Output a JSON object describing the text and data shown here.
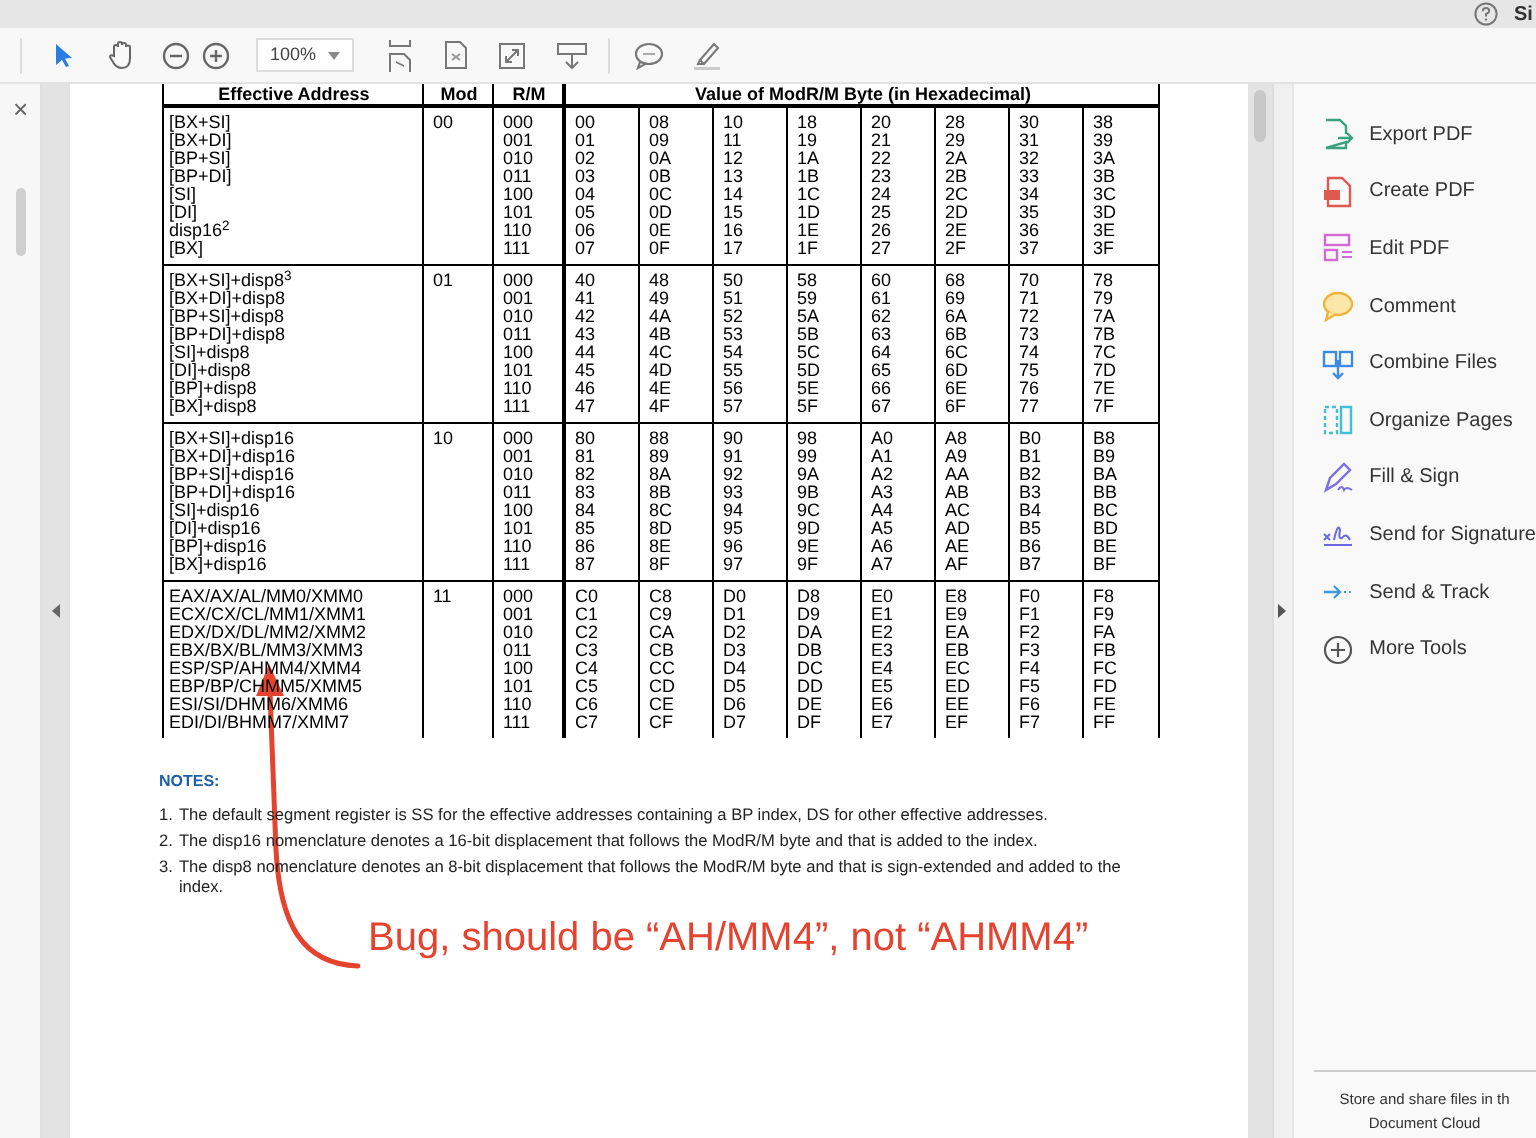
{
  "top_bar": {
    "text": "Si"
  },
  "toolbar": {
    "zoom": "100%"
  },
  "left_panel": {
    "close": "×"
  },
  "table": {
    "columns": [
      "Effective Address",
      "Mod",
      "R/M",
      "Value of ModR/M Byte (in Hexadecimal)"
    ],
    "groups": [
      {
        "mod": "00",
        "rows": [
          {
            "address": "[BX+SI]",
            "rm": "000",
            "values": [
              "00",
              "08",
              "10",
              "18",
              "20",
              "28",
              "30",
              "38"
            ]
          },
          {
            "address": "[BX+DI]",
            "rm": "001",
            "values": [
              "01",
              "09",
              "11",
              "19",
              "21",
              "29",
              "31",
              "39"
            ]
          },
          {
            "address": "[BP+SI]",
            "rm": "010",
            "values": [
              "02",
              "0A",
              "12",
              "1A",
              "22",
              "2A",
              "32",
              "3A"
            ]
          },
          {
            "address": "[BP+DI]",
            "rm": "011",
            "values": [
              "03",
              "0B",
              "13",
              "1B",
              "23",
              "2B",
              "33",
              "3B"
            ]
          },
          {
            "address": "[SI]",
            "rm": "100",
            "values": [
              "04",
              "0C",
              "14",
              "1C",
              "24",
              "2C",
              "34",
              "3C"
            ]
          },
          {
            "address": "[DI]",
            "rm": "101",
            "values": [
              "05",
              "0D",
              "15",
              "1D",
              "25",
              "2D",
              "35",
              "3D"
            ]
          },
          {
            "address": "disp16$^{2}$",
            "rm": "110",
            "values": [
              "06",
              "0E",
              "16",
              "1E",
              "26",
              "2E",
              "36",
              "3E"
            ]
          },
          {
            "address": "[BX]",
            "rm": "111",
            "values": [
              "07",
              "0F",
              "17",
              "1F",
              "27",
              "2F",
              "37",
              "3F"
            ]
          }
        ]
      },
      {
        "mod": "01",
        "rows": [
          {
            "address": "[BX+SI]+disp8$^{3}$",
            "rm": "000",
            "values": [
              "40",
              "48",
              "50",
              "58",
              "60",
              "68",
              "70",
              "78"
            ]
          },
          {
            "address": "[BX+DI]+disp8",
            "rm": "001",
            "values": [
              "41",
              "49",
              "51",
              "59",
              "61",
              "69",
              "71",
              "79"
            ]
          },
          {
            "address": "[BP+SI]+disp8",
            "rm": "010",
            "values": [
              "42",
              "4A",
              "52",
              "5A",
              "62",
              "6A",
              "72",
              "7A"
            ]
          },
          {
            "address": "[BP+DI]+disp8",
            "rm": "011",
            "values": [
              "43",
              "4B",
              "53",
              "5B",
              "63",
              "6B",
              "73",
              "7B"
            ]
          },
          {
            "address": "[SI]+disp8",
            "rm": "100",
            "values": [
              "44",
              "4C",
              "54",
              "5C",
              "64",
              "6C",
              "74",
              "7C"
            ]
          },
          {
            "address": "[DI]+disp8",
            "rm": "101",
            "values": [
              "45",
              "4D",
              "55",
              "5D",
              "65",
              "6D",
              "75",
              "7D"
            ]
          },
          {
            "address": "[BP]+disp8",
            "rm": "110",
            "values": [
              "46",
              "4E",
              "56",
              "5E",
              "66",
              "6E",
              "76",
              "7E"
            ]
          },
          {
            "address": "[BX]+disp8",
            "rm": "111",
            "values": [
              "47",
              "4F",
              "57",
              "5F",
              "67",
              "6F",
              "77",
              "7F"
            ]
          }
        ]
      },
      {
        "mod": "10",
        "rows": [
          {
            "address": "[BX+SI]+disp16",
            "rm": "000",
            "values": [
              "80",
              "88",
              "90",
              "98",
              "A0",
              "A8",
              "B0",
              "B8"
            ]
          },
          {
            "address": "[BX+DI]+disp16",
            "rm": "001",
            "values": [
              "81",
              "89",
              "91",
              "99",
              "A1",
              "A9",
              "B1",
              "B9"
            ]
          },
          {
            "address": "[BP+SI]+disp16",
            "rm": "010",
            "values": [
              "82",
              "8A",
              "92",
              "9A",
              "A2",
              "AA",
              "B2",
              "BA"
            ]
          },
          {
            "address": "[BP+DI]+disp16",
            "rm": "011",
            "values": [
              "83",
              "8B",
              "93",
              "9B",
              "A3",
              "AB",
              "B3",
              "BB"
            ]
          },
          {
            "address": "[SI]+disp16",
            "rm": "100",
            "values": [
              "84",
              "8C",
              "94",
              "9C",
              "A4",
              "AC",
              "B4",
              "BC"
            ]
          },
          {
            "address": "[DI]+disp16",
            "rm": "101",
            "values": [
              "85",
              "8D",
              "95",
              "9D",
              "A5",
              "AD",
              "B5",
              "BD"
            ]
          },
          {
            "address": "[BP]+disp16",
            "rm": "110",
            "values": [
              "86",
              "8E",
              "96",
              "9E",
              "A6",
              "AE",
              "B6",
              "BE"
            ]
          },
          {
            "address": "[BX]+disp16",
            "rm": "111",
            "values": [
              "87",
              "8F",
              "97",
              "9F",
              "A7",
              "AF",
              "B7",
              "BF"
            ]
          }
        ]
      },
      {
        "mod": "11",
        "rows": [
          {
            "address": "EAX/AX/AL/MM0/XMM0",
            "rm": "000",
            "values": [
              "C0",
              "C8",
              "D0",
              "D8",
              "E0",
              "E8",
              "F0",
              "F8"
            ]
          },
          {
            "address": "ECX/CX/CL/MM1/XMM1",
            "rm": "001",
            "values": [
              "C1",
              "C9",
              "D1",
              "D9",
              "E1",
              "E9",
              "F1",
              "F9"
            ]
          },
          {
            "address": "EDX/DX/DL/MM2/XMM2",
            "rm": "010",
            "values": [
              "C2",
              "CA",
              "D2",
              "DA",
              "E2",
              "EA",
              "F2",
              "FA"
            ]
          },
          {
            "address": "EBX/BX/BL/MM3/XMM3",
            "rm": "011",
            "values": [
              "C3",
              "CB",
              "D3",
              "DB",
              "E3",
              "EB",
              "F3",
              "FB"
            ]
          },
          {
            "address": "ESP/SP/AHMM4/XMM4",
            "rm": "100",
            "values": [
              "C4",
              "CC",
              "D4",
              "DC",
              "E4",
              "EC",
              "F4",
              "FC"
            ]
          },
          {
            "address": "EBP/BP/CHMM5/XMM5",
            "rm": "101",
            "values": [
              "C5",
              "CD",
              "D5",
              "DD",
              "E5",
              "ED",
              "F5",
              "FD"
            ]
          },
          {
            "address": "ESI/SI/DHMM6/XMM6",
            "rm": "110",
            "values": [
              "C6",
              "CE",
              "D6",
              "DE",
              "E6",
              "EE",
              "F6",
              "FE"
            ]
          },
          {
            "address": "EDI/DI/BHMM7/XMM7",
            "rm": "111",
            "values": [
              "C7",
              "CF",
              "D7",
              "DF",
              "E7",
              "EF",
              "F7",
              "FF"
            ]
          }
        ]
      }
    ]
  },
  "notes": {
    "heading": "NOTES:",
    "items": [
      {
        "number": "1.",
        "text": "The default segment register is SS for the effective addresses containing a BP index, DS for other effective addresses."
      },
      {
        "number": "2.",
        "text": "The disp16 nomenclature denotes a 16-bit displacement that follows the ModR/M byte and that is added to the index."
      },
      {
        "number": "3.",
        "text": "The disp8 nomenclature denotes an 8-bit displacement that follows the ModR/M byte and that is sign-extended and added to the index."
      }
    ]
  },
  "annotation": {
    "text": "Bug, should be “AH/MM4”, not “AHMM4”"
  },
  "tools_panel": {
    "items": [
      {
        "kind": "export",
        "label": "Export PDF"
      },
      {
        "kind": "create",
        "label": "Create PDF"
      },
      {
        "kind": "edit",
        "label": "Edit PDF"
      },
      {
        "kind": "comment",
        "label": "Comment"
      },
      {
        "kind": "combine",
        "label": "Combine Files"
      },
      {
        "kind": "organize",
        "label": "Organize Pages"
      },
      {
        "kind": "fill_sign",
        "label": "Fill & Sign"
      },
      {
        "kind": "send_signature",
        "label": "Send for Signature"
      },
      {
        "kind": "send_track",
        "label": "Send & Track"
      },
      {
        "kind": "more",
        "label": "More Tools"
      }
    ],
    "footer": [
      "Store and share files in th",
      "Document Cloud"
    ]
  }
}
